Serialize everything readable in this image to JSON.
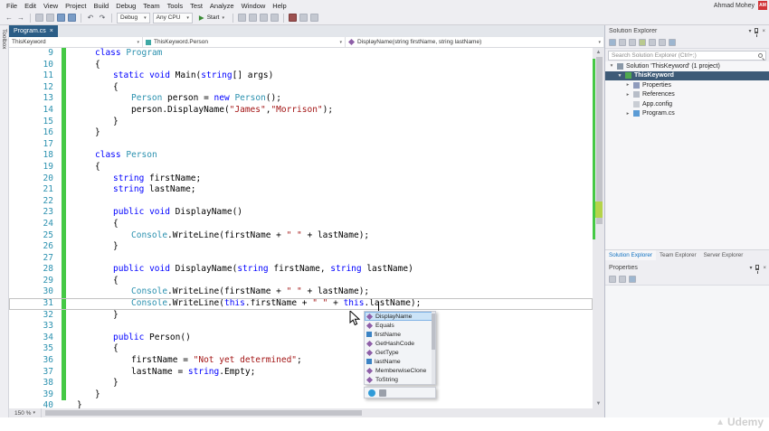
{
  "window": {
    "user_name": "Ahmad Mohey",
    "avatar_initials": "AM"
  },
  "icons": {
    "close": "×",
    "chevron_down": "▾",
    "expand": "▾",
    "collapse": "▸",
    "back": "←",
    "forward": "→",
    "play": "▶",
    "undo": "↶",
    "redo": "↷",
    "up_arrow": "▲",
    "down_arrow": "▼",
    "logo_triangle": "▲"
  },
  "menu": {
    "items": [
      "File",
      "Edit",
      "View",
      "Project",
      "Build",
      "Debug",
      "Team",
      "Tools",
      "Test",
      "Analyze",
      "Window",
      "Help"
    ]
  },
  "toolbar": {
    "debug_config": "Debug",
    "cpu_config": "Any CPU",
    "start_label": "Start"
  },
  "editor": {
    "tab": {
      "title": "Program.cs"
    },
    "toolbox_tab": "Toolbox",
    "navbar": {
      "project": "ThisKeyword",
      "type": "ThisKeyword.Person",
      "member": "DisplayName(string firstName, string lastName)"
    },
    "zoom": "150 %",
    "current_line": 31,
    "lines": [
      {
        "n": 9,
        "i": 1,
        "c": 1,
        "s": [
          [
            "k",
            "class"
          ],
          [
            "p",
            " "
          ],
          [
            "t",
            "Program"
          ]
        ]
      },
      {
        "n": 10,
        "i": 1,
        "c": 1,
        "s": [
          [
            "p",
            "{"
          ]
        ]
      },
      {
        "n": 11,
        "i": 2,
        "c": 1,
        "s": [
          [
            "k",
            "static"
          ],
          [
            "p",
            " "
          ],
          [
            "k",
            "void"
          ],
          [
            "p",
            " Main("
          ],
          [
            "k",
            "string"
          ],
          [
            "p",
            "[] args)"
          ]
        ]
      },
      {
        "n": 12,
        "i": 2,
        "c": 1,
        "s": [
          [
            "p",
            "{"
          ]
        ]
      },
      {
        "n": 13,
        "i": 3,
        "c": 1,
        "s": [
          [
            "t",
            "Person"
          ],
          [
            "p",
            " person = "
          ],
          [
            "k",
            "new"
          ],
          [
            "p",
            " "
          ],
          [
            "t",
            "Person"
          ],
          [
            "p",
            "();"
          ]
        ]
      },
      {
        "n": 14,
        "i": 3,
        "c": 1,
        "s": [
          [
            "p",
            "person.DisplayName("
          ],
          [
            "s",
            "\"James\""
          ],
          [
            "p",
            ","
          ],
          [
            "s",
            "\"Morrison\""
          ],
          [
            "p",
            ");"
          ]
        ]
      },
      {
        "n": 15,
        "i": 2,
        "c": 1,
        "s": [
          [
            "p",
            "}"
          ]
        ]
      },
      {
        "n": 16,
        "i": 1,
        "c": 1,
        "s": [
          [
            "p",
            "}"
          ]
        ]
      },
      {
        "n": 17,
        "i": 1,
        "c": 1,
        "s": []
      },
      {
        "n": 18,
        "i": 1,
        "c": 1,
        "s": [
          [
            "k",
            "class"
          ],
          [
            "p",
            " "
          ],
          [
            "t",
            "Person"
          ]
        ]
      },
      {
        "n": 19,
        "i": 1,
        "c": 1,
        "s": [
          [
            "p",
            "{"
          ]
        ]
      },
      {
        "n": 20,
        "i": 2,
        "c": 1,
        "s": [
          [
            "k",
            "string"
          ],
          [
            "p",
            " firstName;"
          ]
        ]
      },
      {
        "n": 21,
        "i": 2,
        "c": 1,
        "s": [
          [
            "k",
            "string"
          ],
          [
            "p",
            " lastName;"
          ]
        ]
      },
      {
        "n": 22,
        "i": 2,
        "c": 1,
        "s": []
      },
      {
        "n": 23,
        "i": 2,
        "c": 1,
        "s": [
          [
            "k",
            "public"
          ],
          [
            "p",
            " "
          ],
          [
            "k",
            "void"
          ],
          [
            "p",
            " DisplayName()"
          ]
        ]
      },
      {
        "n": 24,
        "i": 2,
        "c": 1,
        "s": [
          [
            "p",
            "{"
          ]
        ]
      },
      {
        "n": 25,
        "i": 3,
        "c": 1,
        "s": [
          [
            "t",
            "Console"
          ],
          [
            "p",
            ".WriteLine(firstName + "
          ],
          [
            "s",
            "\" \""
          ],
          [
            "p",
            " + lastName);"
          ]
        ]
      },
      {
        "n": 26,
        "i": 2,
        "c": 1,
        "s": [
          [
            "p",
            "}"
          ]
        ]
      },
      {
        "n": 27,
        "i": 2,
        "c": 1,
        "s": []
      },
      {
        "n": 28,
        "i": 2,
        "c": 1,
        "s": [
          [
            "k",
            "public"
          ],
          [
            "p",
            " "
          ],
          [
            "k",
            "void"
          ],
          [
            "p",
            " DisplayName("
          ],
          [
            "k",
            "string"
          ],
          [
            "p",
            " firstName, "
          ],
          [
            "k",
            "string"
          ],
          [
            "p",
            " lastName)"
          ]
        ]
      },
      {
        "n": 29,
        "i": 2,
        "c": 1,
        "s": [
          [
            "p",
            "{"
          ]
        ]
      },
      {
        "n": 30,
        "i": 3,
        "c": 1,
        "s": [
          [
            "t",
            "Console"
          ],
          [
            "p",
            ".WriteLine(firstName + "
          ],
          [
            "s",
            "\" \""
          ],
          [
            "p",
            " + lastName);"
          ]
        ]
      },
      {
        "n": 31,
        "i": 3,
        "c": 1,
        "s": [
          [
            "t",
            "Console"
          ],
          [
            "p",
            ".WriteLine("
          ],
          [
            "k",
            "this"
          ],
          [
            "p",
            ".firstName + "
          ],
          [
            "s",
            "\" \""
          ],
          [
            "p",
            " + "
          ],
          [
            "k",
            "this"
          ],
          [
            "p",
            ".lastName);"
          ]
        ]
      },
      {
        "n": 32,
        "i": 2,
        "c": 1,
        "s": [
          [
            "p",
            "}"
          ]
        ]
      },
      {
        "n": 33,
        "i": 2,
        "c": 1,
        "s": []
      },
      {
        "n": 34,
        "i": 2,
        "c": 1,
        "s": [
          [
            "k",
            "public"
          ],
          [
            "p",
            " Person()"
          ]
        ]
      },
      {
        "n": 35,
        "i": 2,
        "c": 1,
        "s": [
          [
            "p",
            "{"
          ]
        ]
      },
      {
        "n": 36,
        "i": 3,
        "c": 1,
        "s": [
          [
            "p",
            "firstName = "
          ],
          [
            "s",
            "\"Not yet determined\""
          ],
          [
            "p",
            ";"
          ]
        ]
      },
      {
        "n": 37,
        "i": 3,
        "c": 1,
        "s": [
          [
            "p",
            "lastName = "
          ],
          [
            "k",
            "string"
          ],
          [
            "p",
            ".Empty;"
          ]
        ]
      },
      {
        "n": 38,
        "i": 2,
        "c": 1,
        "s": [
          [
            "p",
            "}"
          ]
        ]
      },
      {
        "n": 39,
        "i": 1,
        "c": 1,
        "s": [
          [
            "p",
            "}"
          ]
        ]
      },
      {
        "n": 40,
        "i": 0,
        "c": 0,
        "s": [
          [
            "p",
            "}"
          ]
        ]
      }
    ]
  },
  "intellisense": {
    "items": [
      {
        "label": "DisplayName",
        "kind": "method",
        "selected": true
      },
      {
        "label": "Equals",
        "kind": "method"
      },
      {
        "label": "firstName",
        "kind": "field"
      },
      {
        "label": "GetHashCode",
        "kind": "method"
      },
      {
        "label": "GetType",
        "kind": "method"
      },
      {
        "label": "lastName",
        "kind": "field"
      },
      {
        "label": "MemberwiseClone",
        "kind": "method"
      },
      {
        "label": "ToString",
        "kind": "method"
      }
    ]
  },
  "solution_explorer": {
    "title": "Solution Explorer",
    "search_placeholder": "Search Solution Explorer (Ctrl+;)",
    "tree": [
      {
        "label": "Solution 'ThisKeyword' (1 project)",
        "depth": 0,
        "arrow": "expanded",
        "icon": "solution"
      },
      {
        "label": "ThisKeyword",
        "depth": 1,
        "arrow": "expanded",
        "icon": "csharp-project",
        "selected": true
      },
      {
        "label": "Properties",
        "depth": 2,
        "arrow": "collapsed",
        "icon": "properties"
      },
      {
        "label": "References",
        "depth": 2,
        "arrow": "collapsed",
        "icon": "references"
      },
      {
        "label": "App.config",
        "depth": 2,
        "arrow": "none",
        "icon": "config-file"
      },
      {
        "label": "Program.cs",
        "depth": 2,
        "arrow": "collapsed",
        "icon": "csharp-file"
      }
    ],
    "bottom_tabs": [
      {
        "label": "Solution Explorer",
        "active": true
      },
      {
        "label": "Team Explorer",
        "active": false
      },
      {
        "label": "Server Explorer",
        "active": false
      }
    ]
  },
  "properties_panel": {
    "title": "Properties"
  },
  "watermark": "Udemy",
  "colors": {
    "accent_blue": "#2b5d86",
    "keyword": "#0000ff",
    "type_name": "#2b91af",
    "string_literal": "#a31515",
    "line_number": "#2b91af",
    "change_bar_green": "#45c945",
    "tree_selection": "#3d5a77"
  }
}
